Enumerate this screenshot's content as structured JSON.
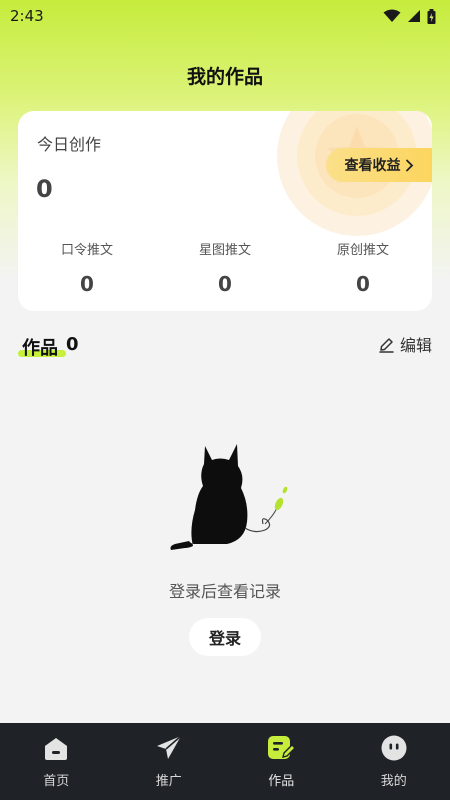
{
  "status_bar": {
    "time": "2:43"
  },
  "header": {
    "title": "我的作品"
  },
  "summary_card": {
    "today_label": "今日创作",
    "today_value": "0",
    "earnings_button": "查看收益",
    "stats": [
      {
        "label": "口令推文",
        "value": "0"
      },
      {
        "label": "星图推文",
        "value": "0"
      },
      {
        "label": "原创推文",
        "value": "0"
      }
    ]
  },
  "works_section": {
    "title": "作品",
    "count": "0",
    "edit_label": "编辑"
  },
  "empty_state": {
    "message": "登录后查看记录",
    "login_button": "登录"
  },
  "tabbar": {
    "items": [
      {
        "label": "首页",
        "icon": "home-icon"
      },
      {
        "label": "推广",
        "icon": "paper-plane-icon"
      },
      {
        "label": "作品",
        "icon": "works-edit-icon",
        "active": true
      },
      {
        "label": "我的",
        "icon": "profile-face-icon"
      }
    ]
  },
  "colors": {
    "accent": "#c6ec3c",
    "tabbar_bg": "#1f2227",
    "earnings_btn": "#fcd55e"
  }
}
